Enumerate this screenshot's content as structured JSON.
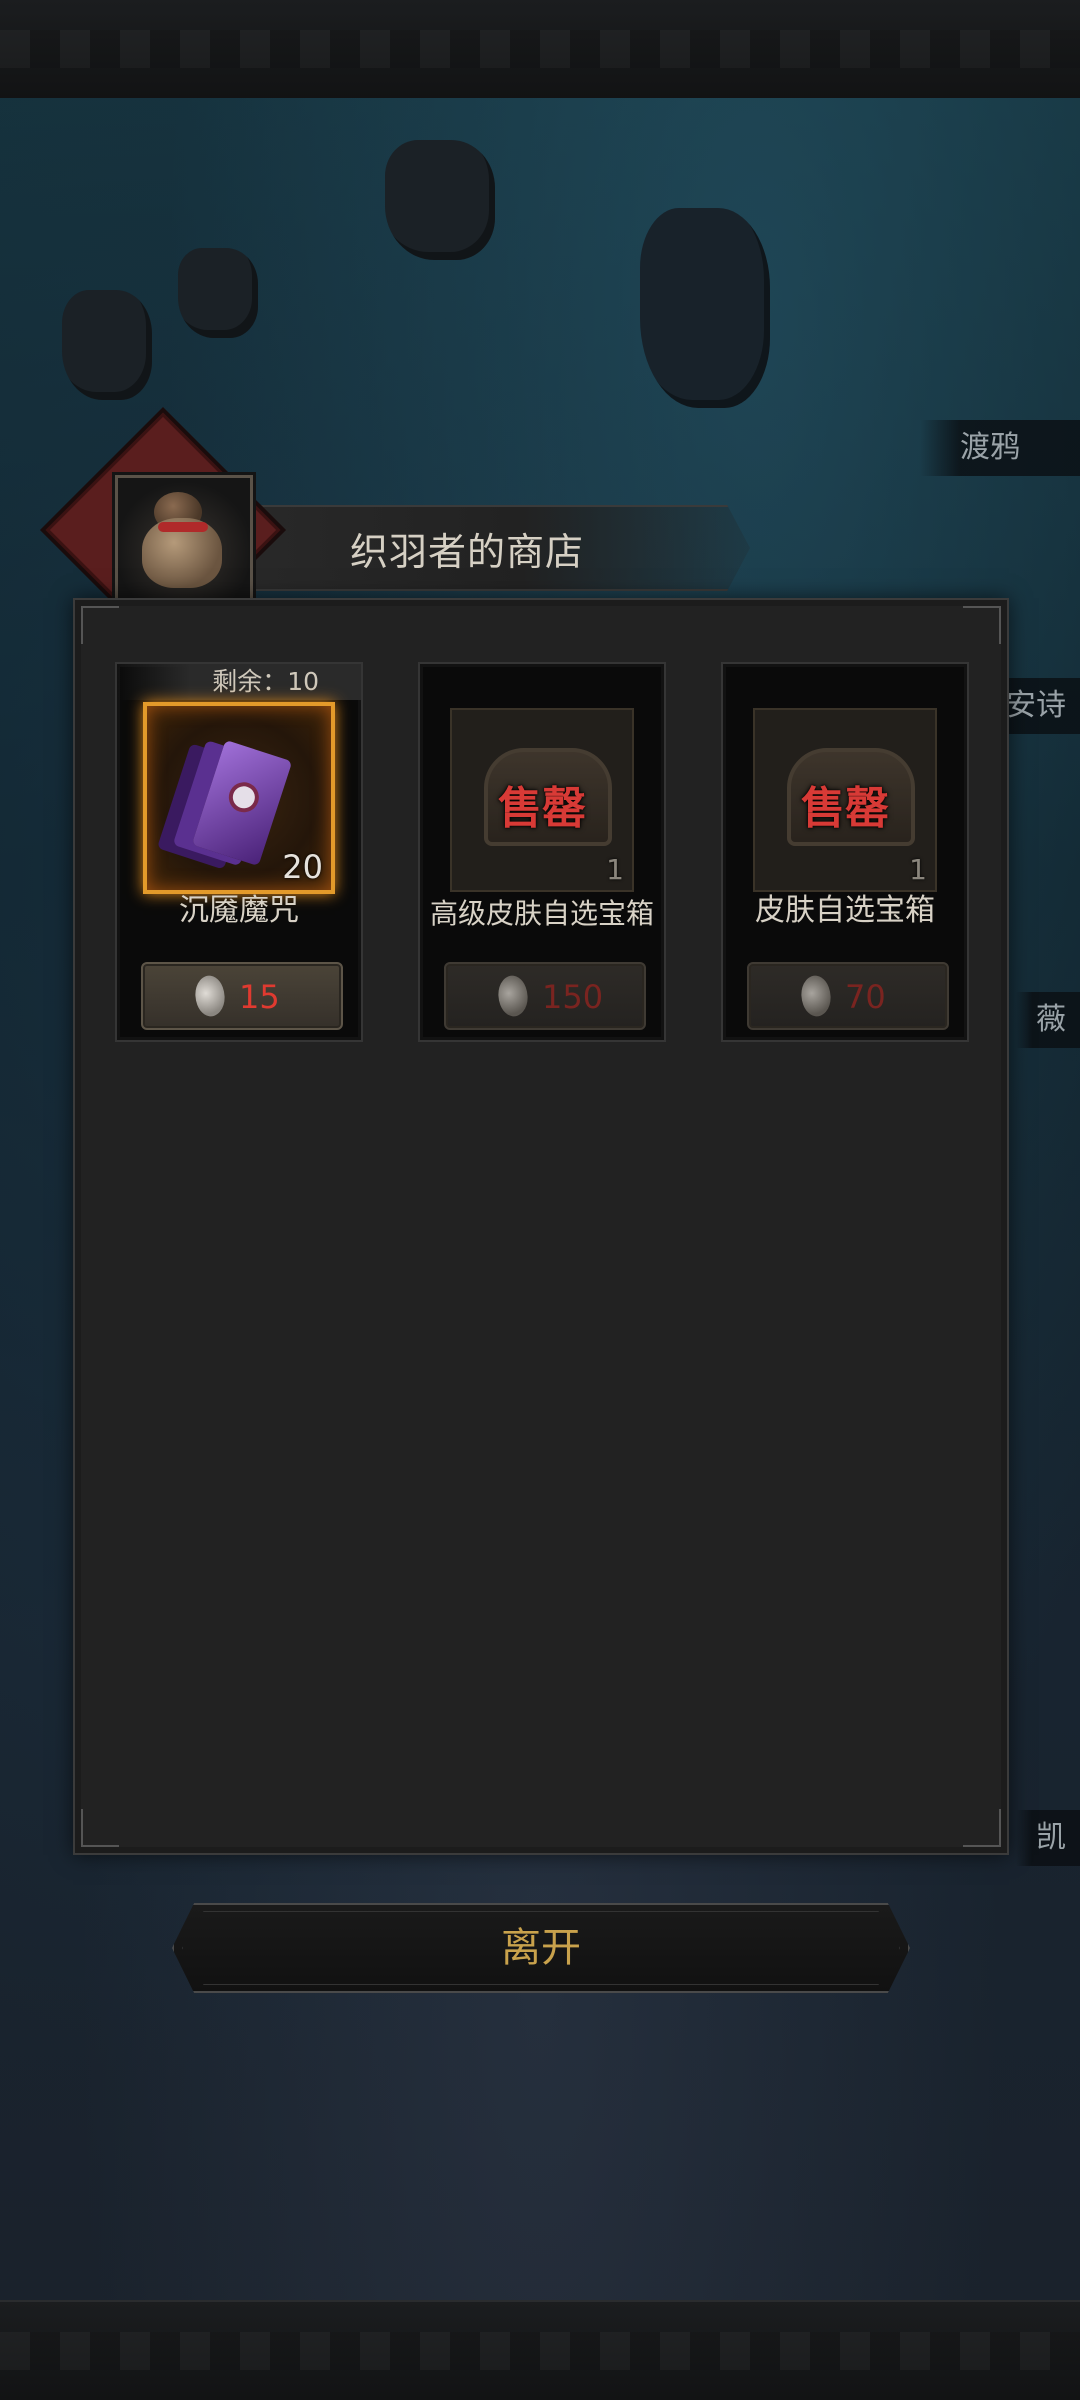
{
  "npc_labels": [
    "渡鸦",
    "安诗",
    "薇",
    "凯"
  ],
  "shop": {
    "title": "织羽者的商店",
    "items": [
      {
        "name": "沉魇魔咒",
        "stock_label": "剩余：10",
        "quantity": "20",
        "price": "15",
        "sold_out": false
      },
      {
        "name": "高级皮肤自选宝箱",
        "quantity": "1",
        "price": "150",
        "sold_out": true,
        "sold_label": "售罄"
      },
      {
        "name": "皮肤自选宝箱",
        "quantity": "1",
        "price": "70",
        "sold_out": true,
        "sold_label": "售罄"
      }
    ]
  },
  "leave_button": {
    "label": "离开"
  },
  "colors": {
    "price": "#e03a30",
    "sold": "#d83a36",
    "leave_text": "#c9a24c",
    "legendary_border": "#e39a2a"
  }
}
